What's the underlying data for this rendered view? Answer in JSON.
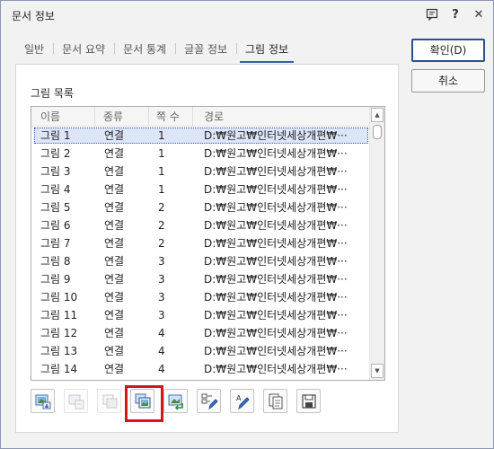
{
  "window": {
    "title": "문서 정보"
  },
  "titlebar_icons": [
    "dialog-help-icon",
    "question-icon",
    "close-icon"
  ],
  "titlebar_text": {
    "question": "?",
    "close": "✕"
  },
  "tabs": [
    {
      "label": "일반"
    },
    {
      "label": "문서 요약"
    },
    {
      "label": "문서 통계"
    },
    {
      "label": "글꼴 정보"
    },
    {
      "label": "그림 정보",
      "active": true
    }
  ],
  "panel": {
    "label": "그림 목록",
    "columns": [
      "이름",
      "종류",
      "쪽 수",
      "경로"
    ],
    "rows": [
      {
        "name": "그림 1",
        "type": "연결",
        "page": "1",
        "path": "D:₩원고₩인터넷세상개편₩···",
        "selected": true
      },
      {
        "name": "그림 2",
        "type": "연결",
        "page": "1",
        "path": "D:₩원고₩인터넷세상개편₩···"
      },
      {
        "name": "그림 3",
        "type": "연결",
        "page": "1",
        "path": "D:₩원고₩인터넷세상개편₩···"
      },
      {
        "name": "그림 4",
        "type": "연결",
        "page": "1",
        "path": "D:₩원고₩인터넷세상개편₩···"
      },
      {
        "name": "그림 5",
        "type": "연결",
        "page": "2",
        "path": "D:₩원고₩인터넷세상개편₩···"
      },
      {
        "name": "그림 6",
        "type": "연결",
        "page": "2",
        "path": "D:₩원고₩인터넷세상개편₩···"
      },
      {
        "name": "그림 7",
        "type": "연결",
        "page": "2",
        "path": "D:₩원고₩인터넷세상개편₩···"
      },
      {
        "name": "그림 8",
        "type": "연결",
        "page": "3",
        "path": "D:₩원고₩인터넷세상개편₩···"
      },
      {
        "name": "그림 9",
        "type": "연결",
        "page": "3",
        "path": "D:₩원고₩인터넷세상개편₩···"
      },
      {
        "name": "그림 10",
        "type": "연결",
        "page": "3",
        "path": "D:₩원고₩인터넷세상개편₩···"
      },
      {
        "name": "그림 11",
        "type": "연결",
        "page": "3",
        "path": "D:₩원고₩인터넷세상개편₩···"
      },
      {
        "name": "그림 12",
        "type": "연결",
        "page": "4",
        "path": "D:₩원고₩인터넷세상개편₩···"
      },
      {
        "name": "그림 13",
        "type": "연결",
        "page": "4",
        "path": "D:₩원고₩인터넷세상개편₩···"
      },
      {
        "name": "그림 14",
        "type": "연결",
        "page": "4",
        "path": "D:₩원고₩인터넷세상개편₩···"
      }
    ],
    "toolbar": [
      {
        "icon": "picture-view-icon",
        "enabled": true
      },
      {
        "icon": "picture-embed-icon",
        "enabled": false
      },
      {
        "icon": "picture-copy-icon",
        "enabled": false
      },
      {
        "icon": "picture-link-icon",
        "enabled": true,
        "highlighted": true
      },
      {
        "icon": "picture-replace-icon",
        "enabled": true
      },
      {
        "icon": "picture-list-edit-icon",
        "enabled": true
      },
      {
        "icon": "caption-edit-icon",
        "enabled": true
      },
      {
        "icon": "copy-list-icon",
        "enabled": true
      },
      {
        "icon": "save-icon",
        "enabled": true
      }
    ]
  },
  "buttons": {
    "ok": "확인(D)",
    "cancel": "취소"
  },
  "colors": {
    "accent": "#3b5ea8",
    "highlight": "#d8141a",
    "selection": "#dce6f7"
  }
}
